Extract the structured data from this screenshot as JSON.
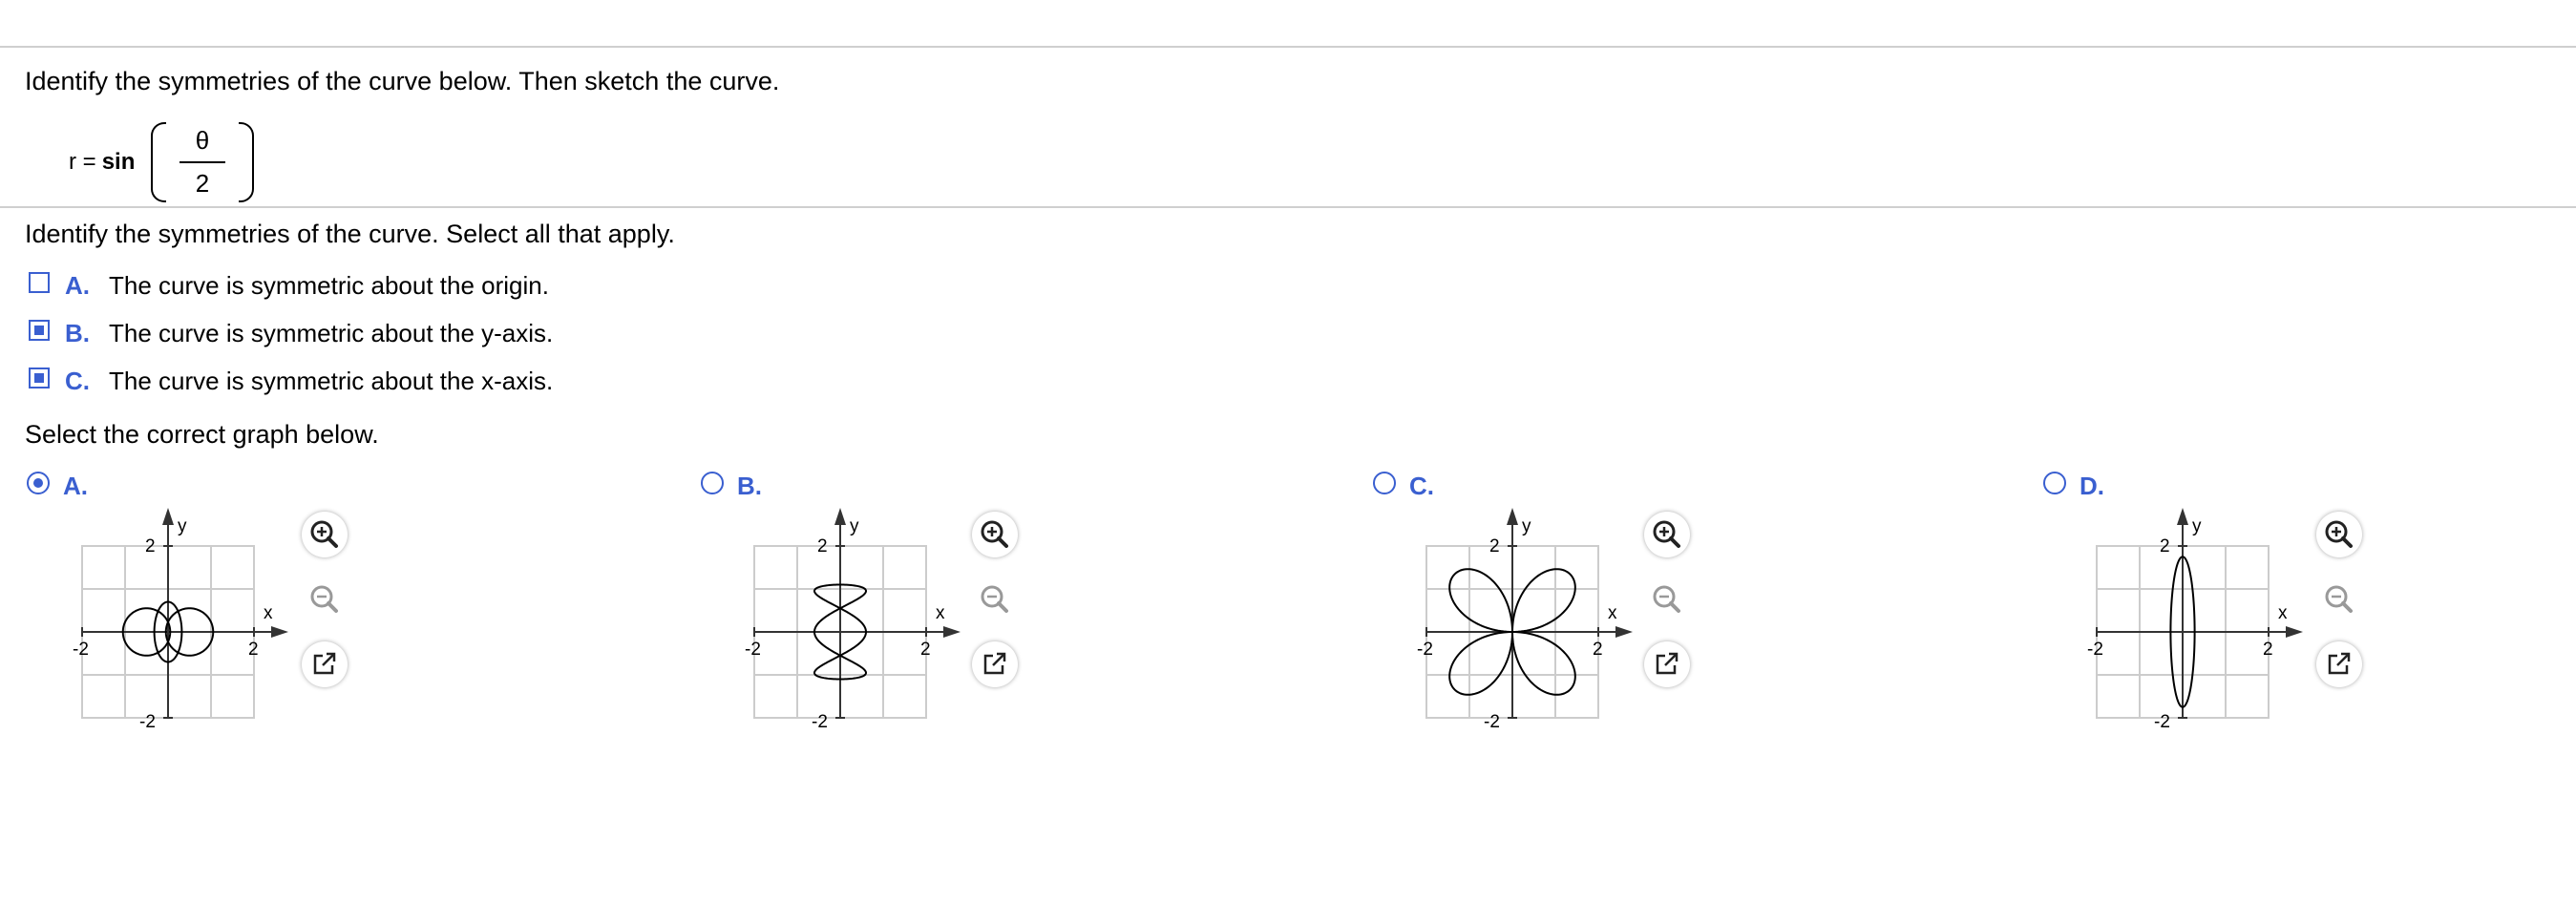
{
  "question": {
    "instruction": "Identify the symmetries of the curve below. Then sketch the curve.",
    "equation": {
      "lhs": "r =",
      "func": "sin",
      "numerator": "θ",
      "denominator": "2"
    }
  },
  "part1": {
    "prompt": "Identify the symmetries of the curve. Select all that apply.",
    "options": [
      {
        "letter": "A.",
        "text": "The curve is symmetric about the origin.",
        "checked": false
      },
      {
        "letter": "B.",
        "text": "The curve is symmetric about the y-axis.",
        "checked": true
      },
      {
        "letter": "C.",
        "text": "The curve is symmetric about the x-axis.",
        "checked": true
      }
    ]
  },
  "part2": {
    "prompt": "Select the correct graph below.",
    "options": [
      {
        "letter": "A.",
        "selected": true,
        "curve": "two-touching-circles"
      },
      {
        "letter": "B.",
        "selected": false,
        "curve": "vertical-loops"
      },
      {
        "letter": "C.",
        "selected": false,
        "curve": "four-petal-rose"
      },
      {
        "letter": "D.",
        "selected": false,
        "curve": "vertical-ellipse"
      }
    ]
  },
  "graph_labels": {
    "y": "y",
    "x": "x",
    "pos": "2",
    "neg": "-2"
  },
  "icons": {
    "zoom_in": "zoom-in-icon",
    "zoom_out": "zoom-out-icon",
    "popout": "popout-icon"
  },
  "colors": {
    "accent": "#3a5fd0",
    "grid": "#cccccc",
    "rule": "#cfcfcf"
  }
}
